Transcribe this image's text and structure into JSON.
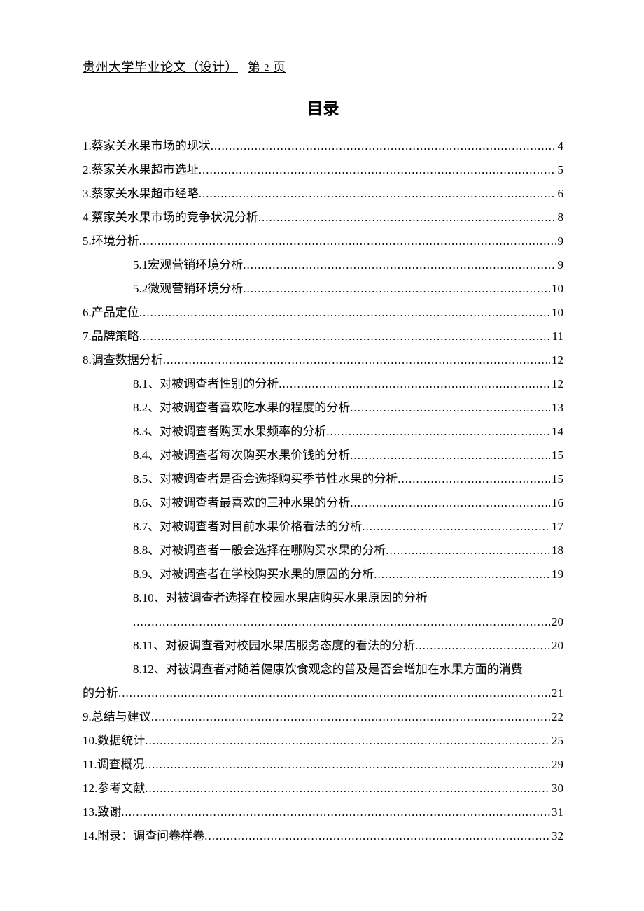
{
  "header": {
    "full": "贵州大学毕业论文（设计）  第 2 页",
    "uni": "贵州大学毕业论文（设计）",
    "page_label_pre": "第",
    "page_num": "2",
    "page_label_post": "页"
  },
  "title": "目录",
  "toc": [
    {
      "label": "1.蔡家关水果市场的现状",
      "page": "4",
      "indent": false
    },
    {
      "label": "2.蔡家关水果超市选址",
      "page": "5",
      "indent": false
    },
    {
      "label": "3.蔡家关水果超市经略",
      "page": "6",
      "indent": false
    },
    {
      "label": "4.蔡家关水果市场的竞争状况分析",
      "page": "8",
      "indent": false
    },
    {
      "label": "5.环境分析 ",
      "page": "9",
      "indent": false
    },
    {
      "label": "5.1宏观营销环境分析",
      "page": "9",
      "indent": true
    },
    {
      "label": "5.2微观营销环境分析",
      "page": "10",
      "indent": true
    },
    {
      "label": "6.产品定位",
      "page": "10",
      "indent": false
    },
    {
      "label": "7.品牌策略",
      "page": "11",
      "indent": false
    },
    {
      "label": "8.调查数据分析 ",
      "page": "12",
      "indent": false
    },
    {
      "label": "8.1、对被调查者性别的分析",
      "page": " 12",
      "indent": true,
      "spc": true
    },
    {
      "label": "8.2、对被调查者喜欢吃水果的程度的分析",
      "page": "13",
      "indent": true
    },
    {
      "label": "8.3、对被调查者购买水果频率的分析",
      "page": "14",
      "indent": true
    },
    {
      "label": "8.4、对被调查者每次购买水果价钱的分析",
      "page": "15",
      "indent": true
    },
    {
      "label": "8.5、对被调查者是否会选择购买季节性水果的分析",
      "page": "15",
      "indent": true
    },
    {
      "label": "8.6、对被调查者最喜欢的三种水果的分析",
      "page": "16",
      "indent": true
    },
    {
      "label": "8.7、对被调查者对目前水果价格看法的分析",
      "page": "17",
      "indent": true
    },
    {
      "label": "8.8、对被调查者一般会选择在哪购买水果的分析",
      "page": "18",
      "indent": true
    },
    {
      "label": "8.9、对被调查者在学校购买水果的原因的分析",
      "page": "19",
      "indent": true
    },
    {
      "label": "8.10、对被调查者选择在校园水果店购买水果原因的分析",
      "page": "",
      "indent": true,
      "nodots": true
    },
    {
      "label": " ",
      "page": "20",
      "indent": true,
      "cont": true
    },
    {
      "label": "8.11、对被调查者对校园水果店服务态度的看法的分析",
      "page": "20",
      "indent": true
    },
    {
      "label": "8.12、对被调查者对随着健康饮食观念的普及是否会增加在水果方面的消费",
      "page": "",
      "indent": true,
      "nodots": true
    },
    {
      "label": "的分析",
      "page": "21",
      "indent": false
    },
    {
      "label": "9.总结与建议",
      "page": "22",
      "indent": false
    },
    {
      "label": "10.数据统计",
      "page": "25",
      "indent": false
    },
    {
      "label": "11.调查概况",
      "page": "29",
      "indent": false
    },
    {
      "label": "12.参考文献",
      "page": "30",
      "indent": false
    },
    {
      "label": "13.致谢",
      "page": "31",
      "indent": false
    },
    {
      "label": "14.附录：调查问卷样卷",
      "page": "32",
      "indent": false
    }
  ]
}
